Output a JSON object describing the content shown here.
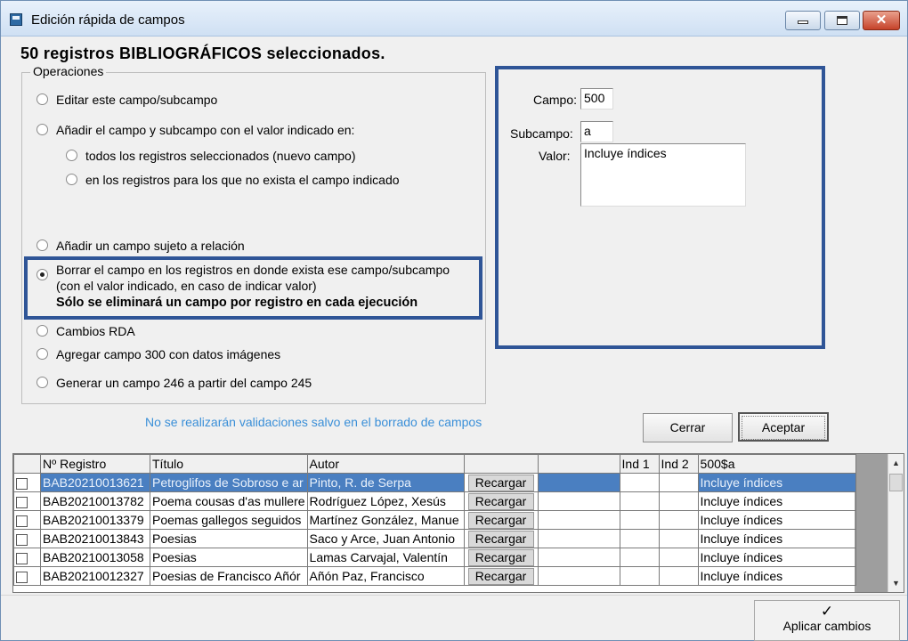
{
  "window": {
    "title": "Edición rápida de campos"
  },
  "header": {
    "title": "50 registros BIBLIOGRÁFICOS seleccionados."
  },
  "operations": {
    "legend": "Operaciones",
    "options": [
      "Editar este campo/subcampo",
      "Añadir el campo y subcampo con el valor indicado en:",
      "todos los registros seleccionados (nuevo campo)",
      "en los registros para los que no exista el campo indicado",
      "Añadir un campo sujeto a relación",
      "Borrar el campo en los registros en donde exista ese campo/subcampo",
      "Cambios RDA",
      "Agregar campo 300 con datos imágenes",
      "Generar un campo 246 a partir del campo 245"
    ],
    "delete_line2": "(con el valor indicado, en caso de indicar valor)",
    "delete_note": "Sólo se eliminará un campo por registro en cada ejecución",
    "selected_index": 5
  },
  "fields": {
    "campo_label": "Campo:",
    "campo_value": "500",
    "subcampo_label": "Subcampo:",
    "subcampo_value": "a",
    "valor_label": "Valor:",
    "valor_value": "Incluye índices"
  },
  "info": "No se realizarán validaciones salvo en el borrado de campos",
  "buttons": {
    "cerrar": "Cerrar",
    "aceptar": "Aceptar",
    "aplicar": "Aplicar cambios"
  },
  "grid": {
    "headers": [
      "",
      "Nº Registro",
      "Título",
      "Autor",
      "",
      "",
      "Ind 1",
      "Ind 2",
      "500$a"
    ],
    "reload_label": "Recargar",
    "rows": [
      {
        "registro": "BAB20210013621",
        "titulo": "Petroglifos de Sobroso e ar",
        "autor": "Pinto, R. de Serpa",
        "valor": "Incluye índices",
        "selected": true
      },
      {
        "registro": "BAB20210013782",
        "titulo": "Poema cousas d'as mullere",
        "autor": "Rodríguez López, Xesús",
        "valor": "Incluye índices",
        "selected": false
      },
      {
        "registro": "BAB20210013379",
        "titulo": "Poemas gallegos seguidos",
        "autor": "Martínez González, Manue",
        "valor": "Incluye índices",
        "selected": false
      },
      {
        "registro": "BAB20210013843",
        "titulo": "Poesias",
        "autor": "Saco y Arce, Juan Antonio",
        "valor": "Incluye índices",
        "selected": false
      },
      {
        "registro": "BAB20210013058",
        "titulo": "Poesias",
        "autor": "Lamas Carvajal, Valentín",
        "valor": "Incluye índices",
        "selected": false
      },
      {
        "registro": "BAB20210012327",
        "titulo": "Poesias de Francisco Añór",
        "autor": "Añón Paz, Francisco",
        "valor": "Incluye índices",
        "selected": false
      }
    ]
  }
}
